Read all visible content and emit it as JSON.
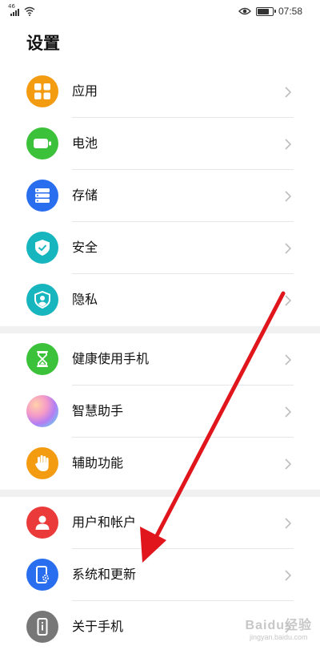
{
  "status_bar": {
    "network_type": "46",
    "time": "07:58",
    "battery_level": 0.85
  },
  "page": {
    "title": "设置"
  },
  "groups": [
    {
      "items": [
        {
          "label": "应用",
          "icon": "apps-icon",
          "color": "#f39c12"
        },
        {
          "label": "电池",
          "icon": "battery-icon",
          "color": "#3cc13b"
        },
        {
          "label": "存储",
          "icon": "storage-icon",
          "color": "#2a6ef0"
        },
        {
          "label": "安全",
          "icon": "security-shield-icon",
          "color": "#17b6bf"
        },
        {
          "label": "隐私",
          "icon": "privacy-icon",
          "color": "#17b6bf"
        }
      ]
    },
    {
      "items": [
        {
          "label": "健康使用手机",
          "icon": "hourglass-icon",
          "color": "#3cc13b"
        },
        {
          "label": "智慧助手",
          "icon": "smart-assistant-icon",
          "color": "#e58ab8"
        },
        {
          "label": "辅助功能",
          "icon": "hand-icon",
          "color": "#f39c12"
        }
      ]
    },
    {
      "items": [
        {
          "label": "用户和帐户",
          "icon": "user-icon",
          "color": "#ea3a3a"
        },
        {
          "label": "系统和更新",
          "icon": "system-update-icon",
          "color": "#2a6ef0"
        },
        {
          "label": "关于手机",
          "icon": "about-phone-icon",
          "color": "#777777"
        }
      ]
    }
  ],
  "annotation": {
    "arrow_color": "#e0161c"
  },
  "watermark": {
    "brand": "Baidu经验",
    "url": "jingyan.baidu.com"
  }
}
